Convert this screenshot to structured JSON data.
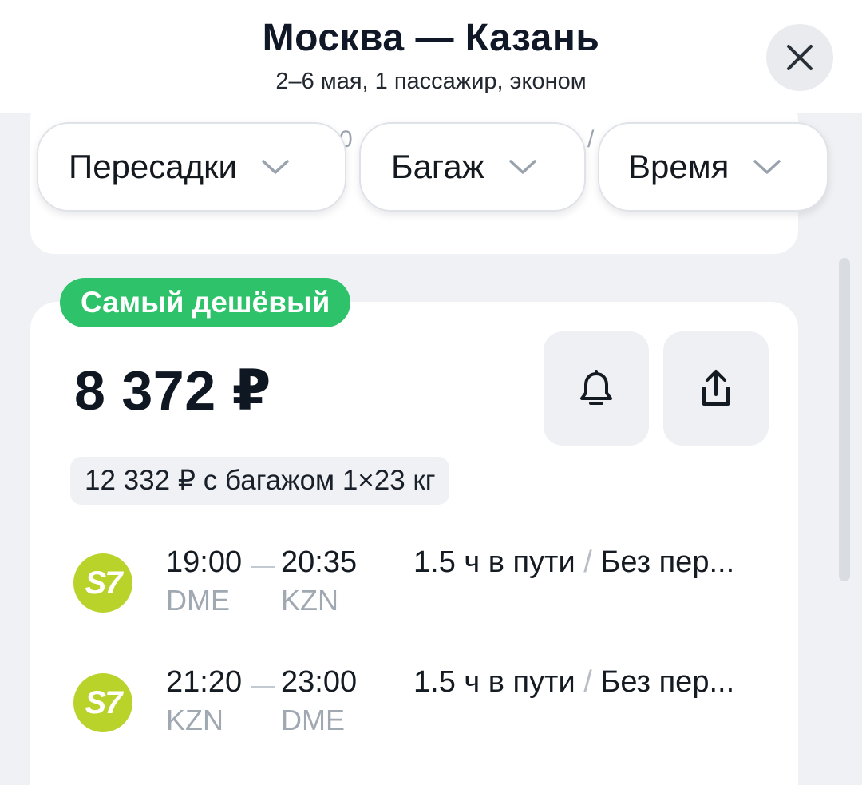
{
  "header": {
    "title": "Москва — Казань",
    "subtitle": "2–6 мая, 1 пассажир, эконом"
  },
  "filters": {
    "peek_left": "0",
    "peek_right": "/",
    "chips": [
      {
        "label": "Пересадки"
      },
      {
        "label": "Багаж"
      },
      {
        "label": "Время"
      }
    ]
  },
  "ticket": {
    "badge": "Самый дешёвый",
    "price": "8 372 ₽",
    "baggage_price": "12 332 ₽ с багажом 1×23 кг",
    "segments": [
      {
        "airline": "S7",
        "depart_time": "19:00",
        "arrive_time": "20:35",
        "from": "DME",
        "to": "KZN",
        "duration": "1.5 ч в пути",
        "separator": "/",
        "stops": "Без пер..."
      },
      {
        "airline": "S7",
        "depart_time": "21:20",
        "arrive_time": "23:00",
        "from": "KZN",
        "to": "DME",
        "duration": "1.5 ч в пути",
        "separator": "/",
        "stops": "Без пер..."
      }
    ]
  },
  "icons": {
    "close": "close-icon",
    "chevron": "chevron-down-icon",
    "subscribe": "bell-icon",
    "share": "share-icon"
  },
  "colors": {
    "badge_green": "#2ec26b",
    "s7_green": "#b9d32b",
    "background": "#eff1f4"
  }
}
